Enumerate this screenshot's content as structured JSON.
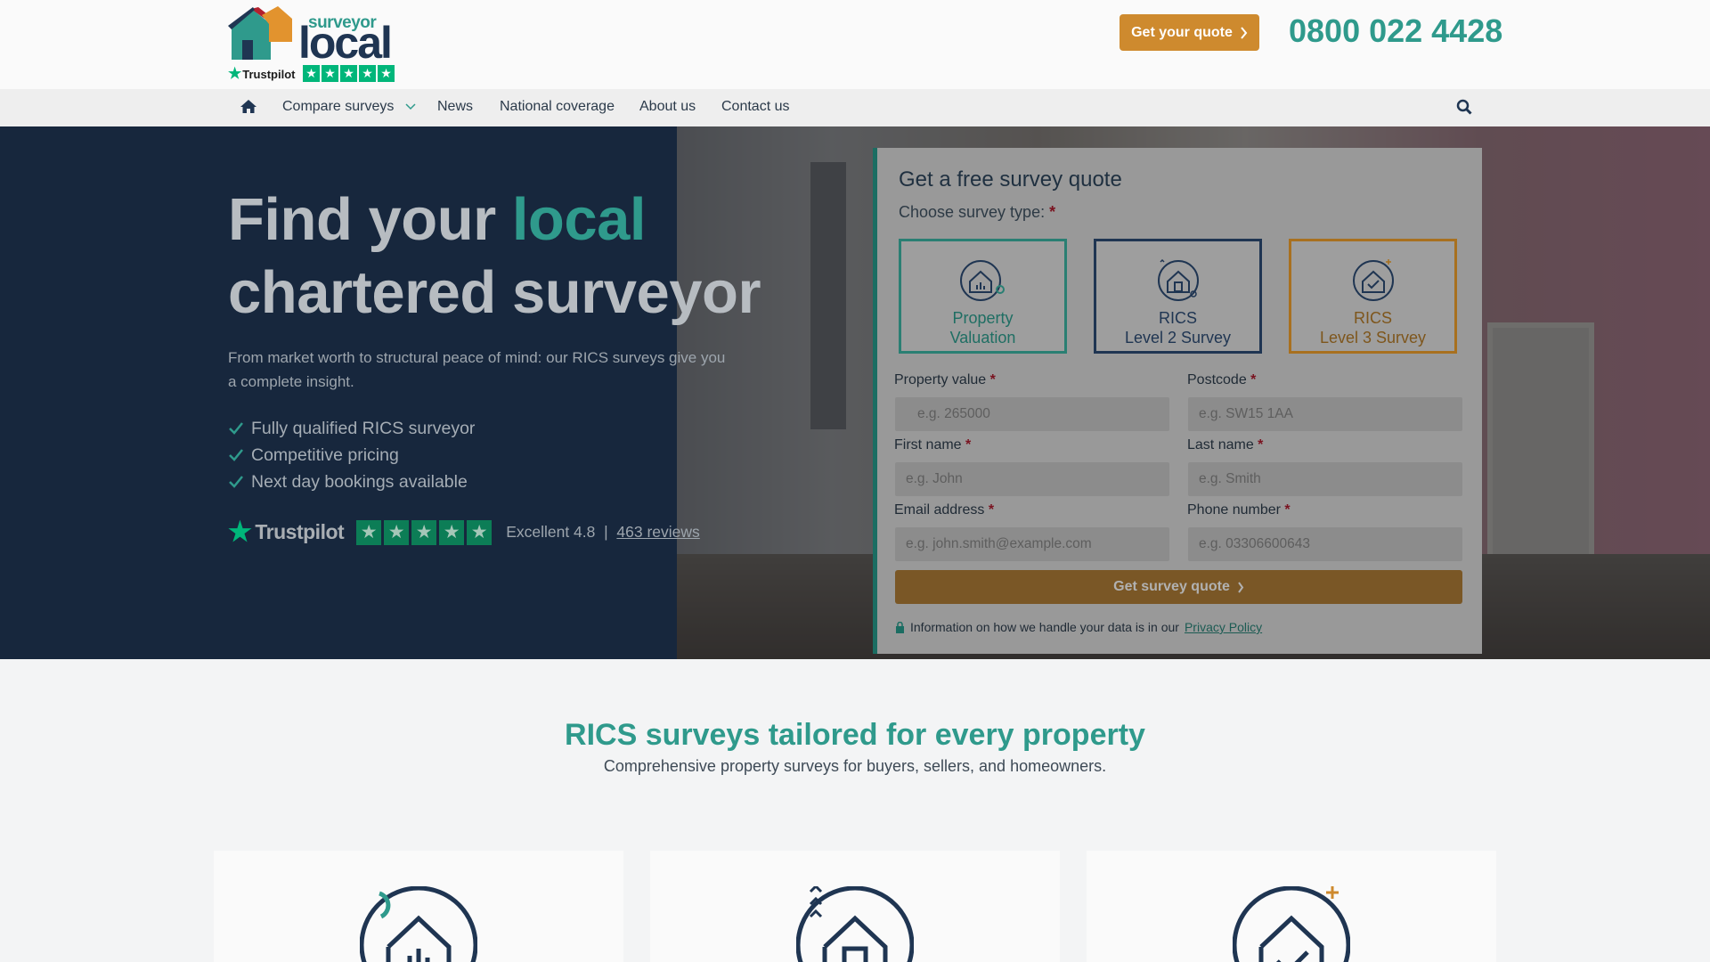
{
  "header": {
    "logo_small": "surveyor",
    "logo_big": "local",
    "trustpilot_label": "Trustpilot",
    "quote_button": "Get your quote",
    "phone": "0800 022 4428"
  },
  "nav": {
    "items": [
      "Compare surveys",
      "News",
      "National coverage",
      "About us",
      "Contact us"
    ]
  },
  "hero": {
    "title_part1": "Find your ",
    "title_accent": "local",
    "title_part2": "chartered surveyor",
    "subtitle": "From market worth to structural peace of mind: our RICS surveys give you a complete insight.",
    "bullets": [
      "Fully qualified RICS surveyor",
      "Competitive pricing",
      "Next day bookings available"
    ],
    "trustpilot": {
      "brand": "Trustpilot",
      "rating_text": "Excellent 4.8",
      "separator": "|",
      "reviews_link": "463 reviews",
      "stars": 5
    }
  },
  "form": {
    "title": "Get a free survey quote",
    "type_label": "Choose survey type:",
    "types": [
      {
        "line1": "Property",
        "line2": "Valuation",
        "color": "#2a7f73"
      },
      {
        "line1": "RICS",
        "line2": "Level 2 Survey",
        "color": "#1f3552"
      },
      {
        "line1": "RICS",
        "line2": "Level 3 Survey",
        "color": "#8c5e1f"
      }
    ],
    "fields": {
      "property_value": {
        "label": "Property value",
        "placeholder": "e.g. 265000",
        "prefix": "£"
      },
      "postcode": {
        "label": "Postcode",
        "placeholder": "e.g. SW15 1AA"
      },
      "first_name": {
        "label": "First name",
        "placeholder": "e.g. John"
      },
      "last_name": {
        "label": "Last name",
        "placeholder": "e.g. Smith"
      },
      "email": {
        "label": "Email address",
        "placeholder": "e.g. john.smith@example.com"
      },
      "phone": {
        "label": "Phone number",
        "placeholder": "e.g. 03306600643"
      }
    },
    "required_mark": "*",
    "submit": "Get survey quote",
    "privacy_text": "Information on how we handle your data is in our",
    "privacy_link": "Privacy Policy"
  },
  "section": {
    "title": "RICS surveys tailored for every property",
    "subtitle": "Comprehensive property surveys for buyers, sellers, and homeowners."
  },
  "colors": {
    "accent_teal": "#2f9a8c",
    "navy": "#1f3552",
    "orange": "#ce8a2e",
    "trustpilot_green": "#00b67a"
  },
  "icons": [
    "home-icon",
    "chevron-down-icon",
    "search-icon",
    "chevron-right-icon",
    "check-icon",
    "lock-icon",
    "valuation-house-icon",
    "level2-house-icon",
    "level3-house-icon"
  ]
}
